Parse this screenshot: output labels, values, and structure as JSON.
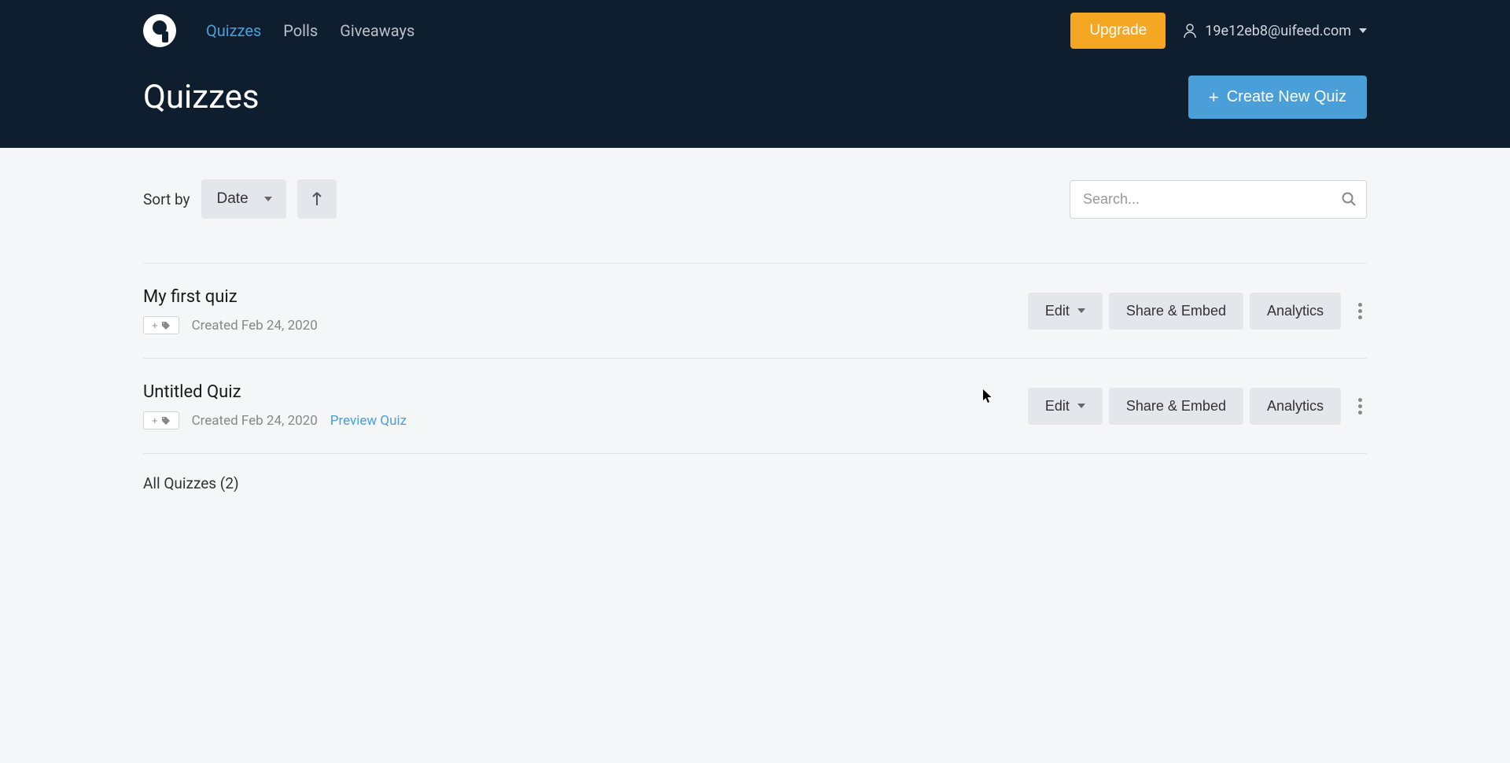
{
  "nav": {
    "quizzes": "Quizzes",
    "polls": "Polls",
    "giveaways": "Giveaways",
    "upgrade": "Upgrade",
    "user_email": "19e12eb8@uifeed.com"
  },
  "page": {
    "title": "Quizzes",
    "create_btn": "Create New Quiz"
  },
  "toolbar": {
    "sort_label": "Sort by",
    "sort_value": "Date",
    "search_placeholder": "Search..."
  },
  "quizzes": [
    {
      "title": "My first quiz",
      "date": "Created Feb 24, 2020",
      "tag_btn": "+",
      "preview": null,
      "edit": "Edit",
      "share": "Share & Embed",
      "analytics": "Analytics"
    },
    {
      "title": "Untitled Quiz",
      "date": "Created Feb 24, 2020",
      "tag_btn": "+",
      "preview": "Preview Quiz",
      "edit": "Edit",
      "share": "Share & Embed",
      "analytics": "Analytics"
    }
  ],
  "footer": {
    "count_text": "All Quizzes (2)"
  }
}
